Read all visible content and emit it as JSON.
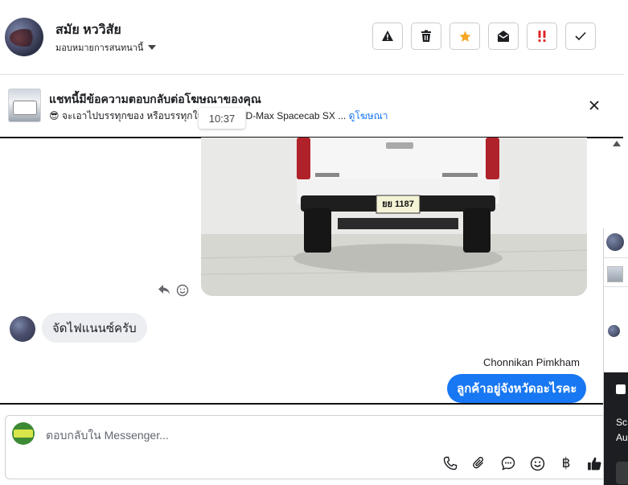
{
  "header": {
    "contact_name": "สมัย หววิสัย",
    "assign_label": "มอบหมายการสนทนานี้",
    "tools": [
      {
        "name": "report-spam-button",
        "icon": "warning-icon"
      },
      {
        "name": "delete-button",
        "icon": "trash-icon"
      },
      {
        "name": "star-button",
        "icon": "star-icon"
      },
      {
        "name": "mark-unread-button",
        "icon": "envelope-open-icon"
      },
      {
        "name": "follow-up-button",
        "icon": "exclamation-icon"
      },
      {
        "name": "mark-done-button",
        "icon": "check-icon"
      }
    ]
  },
  "ad_banner": {
    "title": "แชทนี้มีข้อความตอบกลับต่อโฆษณาของคุณ",
    "emoji": "😎",
    "description": "จะเอาไปบรรทุกของ หรือบรรทุกใจเธอก็ได้... D-Max Spacecab SX ...",
    "link": "ดูโฆษณา",
    "time": "10:37"
  },
  "conversation": {
    "incoming_message": "จัดไฟแนนซ์ครับ",
    "sender_name": "Chonnikan Pimkham",
    "outgoing_message": "ลูกค้าอยู่จังหวัดอะไรคะ",
    "plate_text": "ยย 1187"
  },
  "composer": {
    "placeholder": "ตอบกลับใน Messenger...",
    "currency_symbol": "฿"
  },
  "right_panel": {
    "dark_text_line1": "Sc",
    "dark_text_line2": "Au"
  },
  "colors": {
    "accent": "#1877f2",
    "star": "#f5a623",
    "follow_up": "#e02424"
  }
}
